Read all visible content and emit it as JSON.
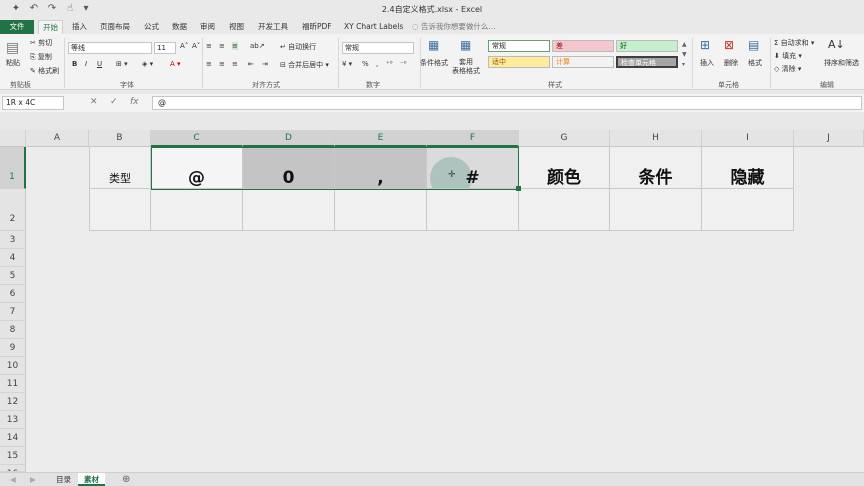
{
  "window": {
    "title": "2.4自定义格式.xlsx - Excel"
  },
  "tabs": [
    "文件",
    "开始",
    "插入",
    "页面布局",
    "公式",
    "数据",
    "审阅",
    "视图",
    "开发工具",
    "福昕PDF",
    "XY Chart Labels"
  ],
  "tell_me": "告诉我你想要做什么...",
  "ribbon": {
    "clipboard": {
      "paste": "粘贴",
      "cut": "剪切",
      "copy": "复制",
      "format_painter": "格式刷",
      "label": "剪贴板"
    },
    "font": {
      "name": "等线",
      "size": "11",
      "bold": "B",
      "italic": "I",
      "underline": "U",
      "label": "字体"
    },
    "alignment": {
      "wrap": "自动换行",
      "merge": "合并后居中",
      "label": "对齐方式"
    },
    "number": {
      "format": "常规",
      "label": "数字"
    },
    "styles": {
      "cond_format": "条件格式",
      "table_format": "套用\n表格格式",
      "cells": [
        "常规",
        "差",
        "好",
        "适中",
        "计算",
        "检查单元格"
      ],
      "label": "样式"
    },
    "cells_group": {
      "insert": "插入",
      "delete": "删除",
      "format": "格式",
      "label": "单元格"
    },
    "editing": {
      "autosum": "自动求和",
      "fill": "填充",
      "clear": "清除",
      "sort": "排序和筛选",
      "label": "编辑"
    }
  },
  "formula_bar": {
    "name_box": "1R x 4C",
    "fx": "fx",
    "content": "@"
  },
  "grid": {
    "columns": [
      "A",
      "B",
      "C",
      "D",
      "E",
      "F",
      "G",
      "H",
      "I",
      "J"
    ],
    "rows": [
      "1",
      "2",
      "3",
      "4",
      "5",
      "6",
      "7",
      "8",
      "9",
      "10",
      "11",
      "12",
      "13",
      "14",
      "15",
      "16"
    ],
    "row1": [
      "",
      "类型",
      "@",
      "0",
      ",",
      "#",
      "颜色",
      "条件",
      "隐藏"
    ]
  },
  "sheets": [
    "目录",
    "素材"
  ],
  "colors": {
    "accent": "#217346",
    "selected_fill": "#c4c4c4"
  }
}
